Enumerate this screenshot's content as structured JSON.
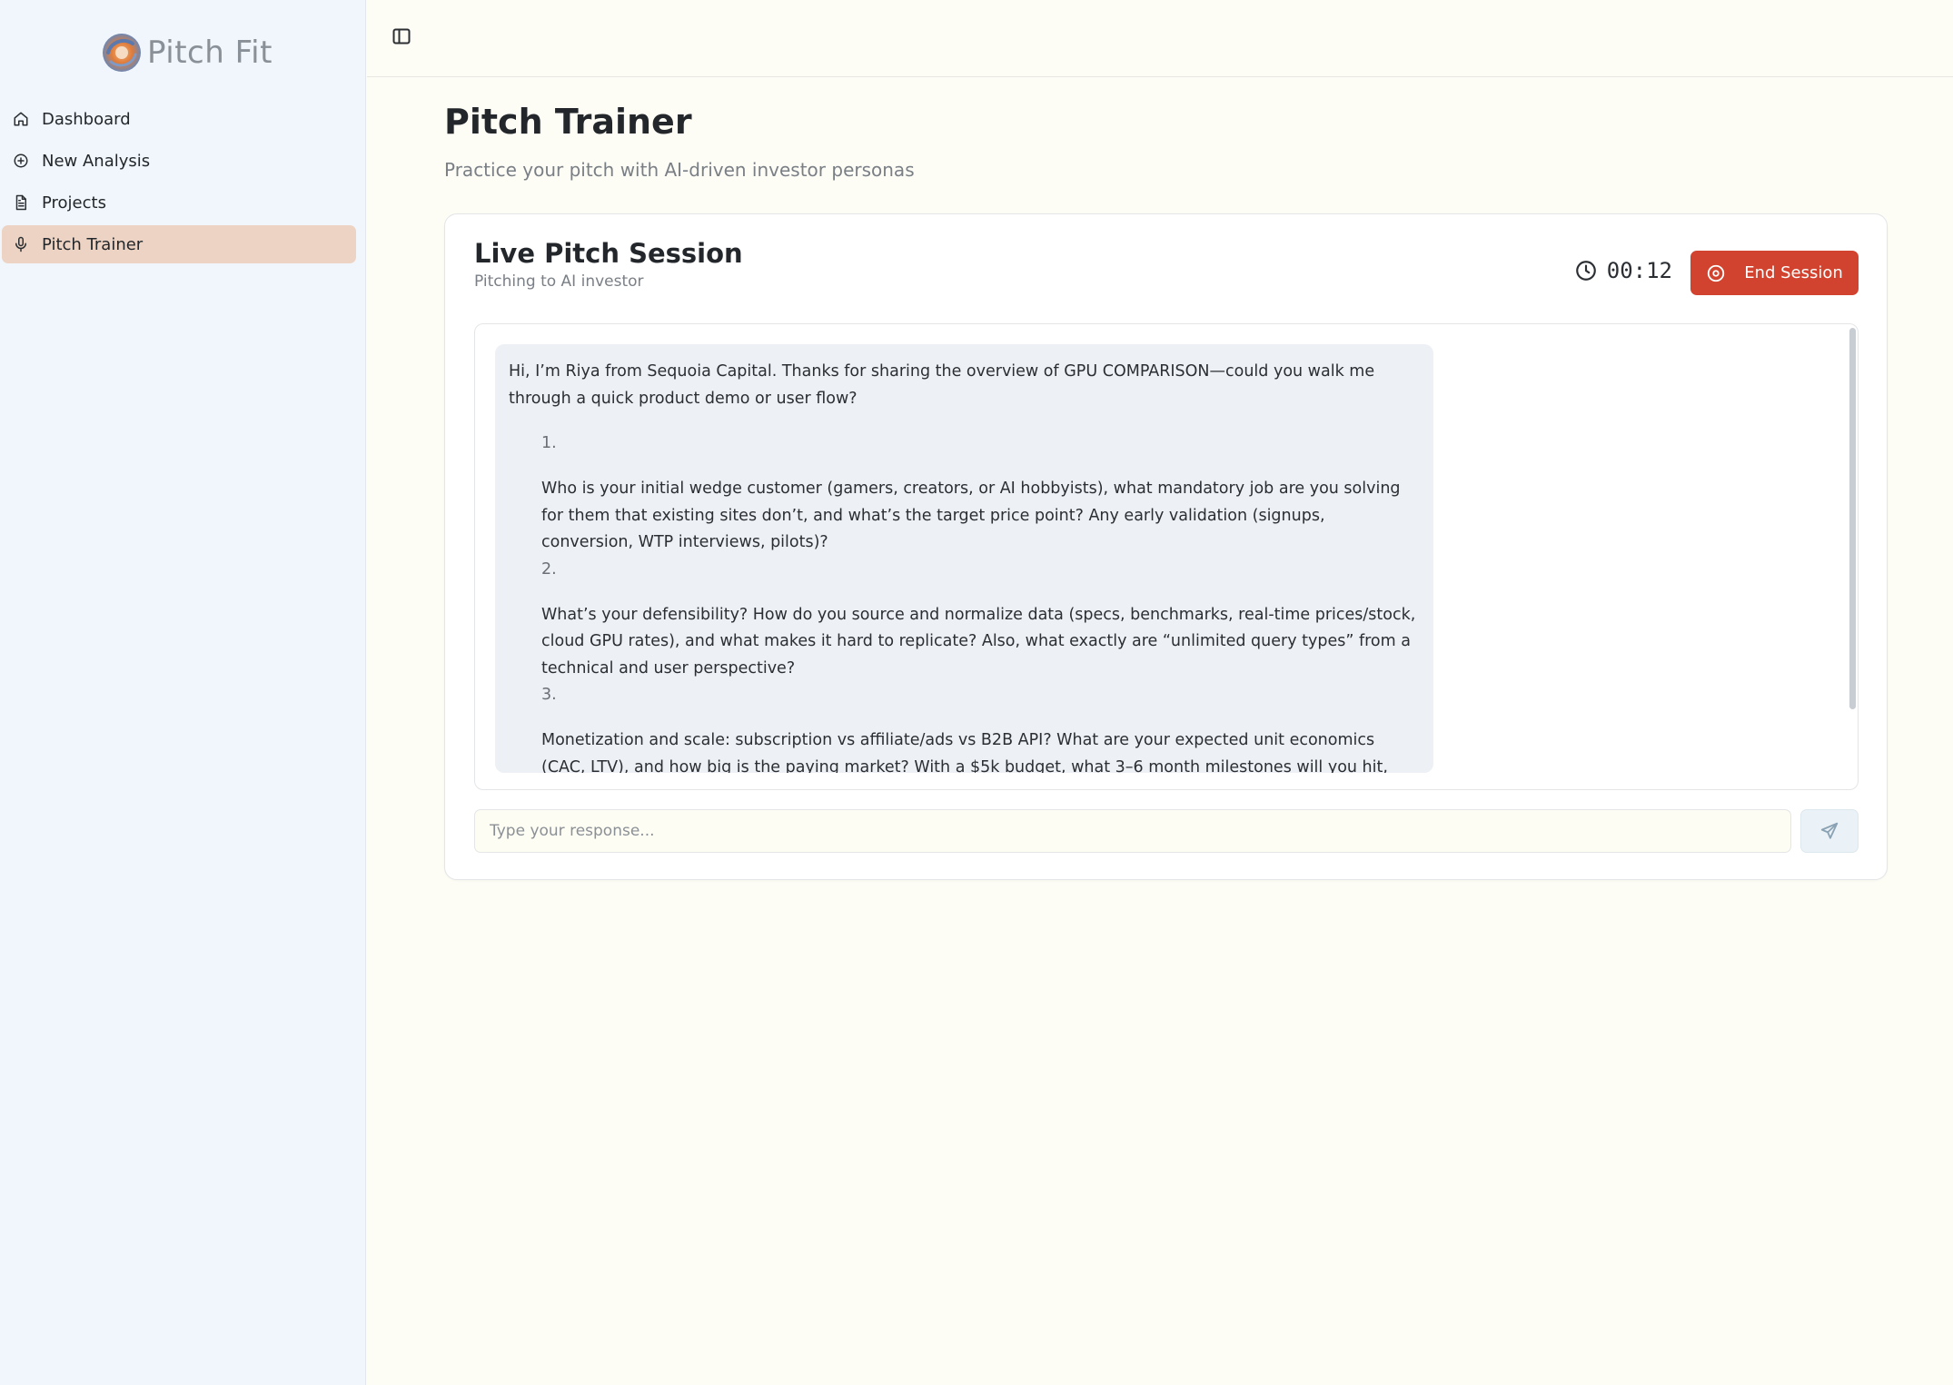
{
  "app": {
    "brand": "Pitch Fit"
  },
  "sidebar": {
    "items": [
      {
        "label": "Dashboard",
        "icon": "home-icon"
      },
      {
        "label": "New Analysis",
        "icon": "plus-circle-icon"
      },
      {
        "label": "Projects",
        "icon": "file-text-icon"
      },
      {
        "label": "Pitch Trainer",
        "icon": "microphone-icon",
        "active": true
      }
    ]
  },
  "page": {
    "title": "Pitch Trainer",
    "subtitle": "Practice your pitch with AI-driven investor personas"
  },
  "session": {
    "title": "Live Pitch Session",
    "subtitle": "Pitching to AI investor",
    "timer": "00:12",
    "end_label": "End Session",
    "end_color": "#d1432e"
  },
  "chat": {
    "message_intro": "Hi, I’m Riya from Sequoia Capital. Thanks for sharing the overview of GPU COMPARISON—could you walk me through a quick product demo or user flow?",
    "questions": [
      {
        "num": "1.",
        "text": "Who is your initial wedge customer (gamers, creators, or AI hobbyists), what mandatory job are you solving for them that existing sites don’t, and what’s the target price point? Any early validation (signups, conversion, WTP interviews, pilots)?"
      },
      {
        "num": "2.",
        "text": "What’s your defensibility? How do you source and normalize data (specs, benchmarks, real-time prices/stock, cloud GPU rates), and what makes it hard to replicate? Also, what exactly are “unlimited query types” from a technical and user perspective?"
      },
      {
        "num": "3.",
        "text": "Monetization and scale: subscription vs affiliate/ads vs B2B API? What are your expected unit economics (CAC, LTV), and how big is the paying market? With a $5k budget, what 3–6 month milestones will you hit, and how does this evolve"
      }
    ]
  },
  "input": {
    "placeholder": "Type your response...",
    "value": ""
  },
  "colors": {
    "sidebar_bg": "#f0f6fb",
    "active_nav": "#edd3c3",
    "page_bg": "#fdfdf5",
    "bubble_bg": "#edf1f5"
  }
}
